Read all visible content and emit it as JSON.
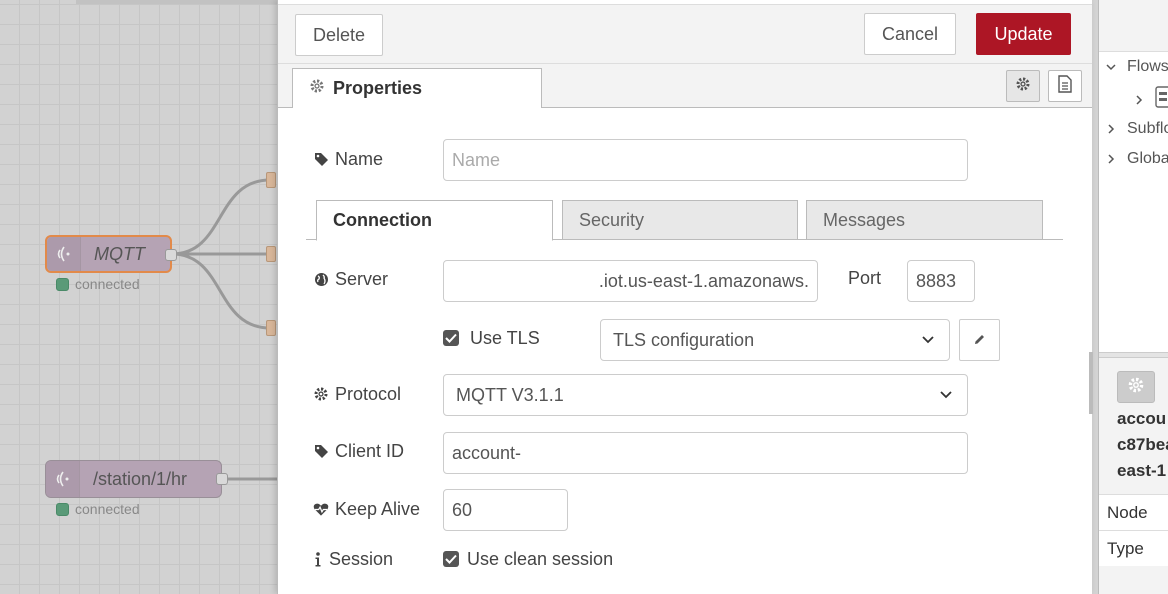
{
  "canvas": {
    "nodes": [
      {
        "label": "MQTT",
        "status": "connected",
        "icon": "wifi-waves-icon"
      },
      {
        "label": "/station/1/hr",
        "status": "connected",
        "icon": "wifi-waves-icon"
      }
    ]
  },
  "toolbar": {
    "delete_label": "Delete",
    "cancel_label": "Cancel",
    "update_label": "Update"
  },
  "tabs": {
    "properties_label": "Properties",
    "settings_icon": "gear-icon",
    "description_icon": "document-icon"
  },
  "form": {
    "name": {
      "label": "Name",
      "value": "",
      "placeholder": "Name"
    },
    "subtabs": [
      "Connection",
      "Security",
      "Messages"
    ],
    "server": {
      "label": "Server",
      "value": ".iot.us-east-1.amazonaws."
    },
    "port": {
      "label": "Port",
      "value": "8883"
    },
    "tls": {
      "label": "Use TLS",
      "checked": true,
      "config_value": "TLS configuration",
      "edit_icon": "pencil-icon"
    },
    "protocol": {
      "label": "Protocol",
      "value": "MQTT V3.1.1"
    },
    "client_id": {
      "label": "Client ID",
      "value": "account-"
    },
    "keep_alive": {
      "label": "Keep Alive",
      "value": "60"
    },
    "session": {
      "label": "Session",
      "checkbox_label": "Use clean session",
      "checked": true
    }
  },
  "sidebar": {
    "tree": [
      {
        "label": "Flows",
        "expanded": true
      },
      {
        "label": "",
        "expanded": false
      },
      {
        "label": "Subflo",
        "expanded": false
      },
      {
        "label": "Globa",
        "expanded": false
      }
    ],
    "info_lines": [
      "accou",
      "c87bea",
      "east-1"
    ],
    "rows": [
      "Node",
      "Type"
    ]
  },
  "colors": {
    "accent": "#ad1625",
    "node_fill": "#b5a3b4",
    "selected_border": "#e28a4a",
    "status_connected": "#5a9a78"
  }
}
